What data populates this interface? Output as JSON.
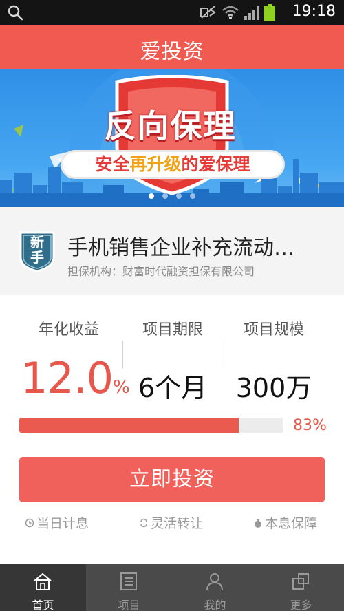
{
  "status_bar": {
    "time": "19:18"
  },
  "header": {
    "title": "爱投资"
  },
  "banner": {
    "headline": "反向保理",
    "slogan_part1": "安全",
    "slogan_highlight": "再升级",
    "slogan_part2": "的爱保理",
    "slides": 4,
    "active_slide": 1
  },
  "product": {
    "badge": "新手",
    "name": "手机销售企业补充流动…",
    "guarantor": "担保机构：财富时代融资担保有限公司"
  },
  "stats": {
    "yield_label": "年化收益",
    "yield_value": "12.0",
    "yield_unit": "%",
    "term_label": "项目期限",
    "term_value": "6个月",
    "scale_label": "项目规模",
    "scale_value": "300万"
  },
  "progress": {
    "percent": 83,
    "text": "83%"
  },
  "invest_button": {
    "label": "立即投资"
  },
  "features": [
    "当日计息",
    "灵活转让",
    "本息保障"
  ],
  "tabs": [
    {
      "label": "首页",
      "icon": "home-icon",
      "active": true
    },
    {
      "label": "项目",
      "icon": "list-icon",
      "active": false
    },
    {
      "label": "我的",
      "icon": "user-icon",
      "active": false
    },
    {
      "label": "更多",
      "icon": "more-icon",
      "active": false
    }
  ],
  "colors": {
    "brand": "#f05a50",
    "progress": "#ea5a4f",
    "tabbar": "#4a4a4a"
  }
}
